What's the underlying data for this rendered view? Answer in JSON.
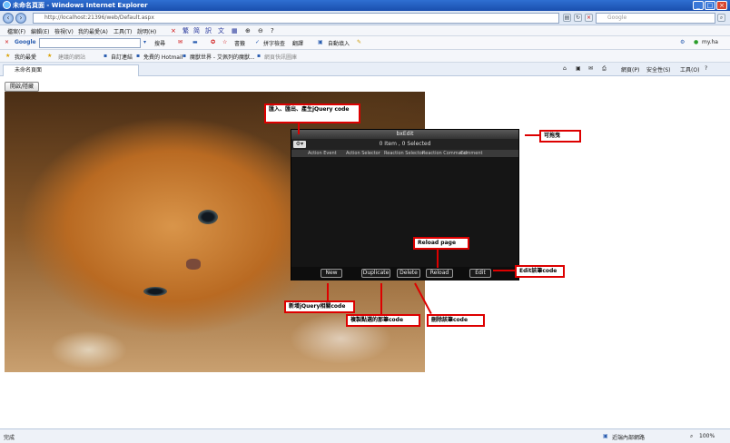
{
  "window": {
    "title": "未命名頁面 - Windows Internet Explorer"
  },
  "address": {
    "url": "http://localhost:21396/web/Default.aspx",
    "search_placeholder": "Google"
  },
  "menu": {
    "items": [
      "檔案(F)",
      "編輯(E)",
      "檢視(V)",
      "我的最愛(A)",
      "工具(T)",
      "說明(H)"
    ]
  },
  "google": {
    "label": "Google",
    "search": "搜尋",
    "bookmarks": "書籤",
    "spell": "拼字檢查",
    "translate": "翻譯",
    "autofill": "自動填入",
    "user": "my.ha"
  },
  "favorites": {
    "label": "我的最愛",
    "items": [
      "建議的網站",
      "自訂連結",
      "免費的 Hotmail",
      "魔獸世界 - 艾佩列的魔獸...",
      "網頁快訊圖庫"
    ]
  },
  "tab": {
    "title": "未命名頁面"
  },
  "cmdbar": {
    "page": "網頁(P)",
    "safety": "安全性(S)",
    "tools": "工具(O)"
  },
  "page": {
    "toggle_label": "開啟/隱藏"
  },
  "panel": {
    "title": "bxEdit",
    "info": "0 Item , 0 Selected",
    "columns": [
      "Action Event",
      "Action Selector",
      "Reaction Selector",
      "Reaction Command",
      "Comment"
    ],
    "buttons": {
      "new": "New",
      "duplicate": "Duplicate",
      "delete": "Delete",
      "reload": "Reload",
      "edit": "Edit"
    }
  },
  "callouts": {
    "import": "匯入、匯出、產生jQuery code",
    "drag": "可拖曳",
    "reload": "Reload page",
    "edit": "Edit該筆code",
    "new": "新增jQuery相關code",
    "duplicate": "複製點選的那筆code",
    "delete": "刪除該筆code"
  },
  "status": {
    "left": "完成",
    "zone": "近端內部網路",
    "zoom": "100%"
  }
}
